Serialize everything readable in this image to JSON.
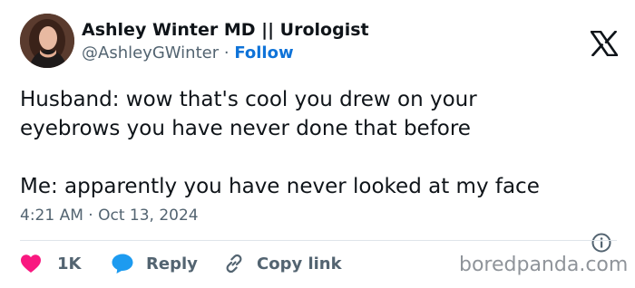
{
  "author": {
    "display_name": "Ashley Winter MD || Urologist",
    "handle": "@AshleyGWinter",
    "separator": "·",
    "follow_label": "Follow"
  },
  "tweet": {
    "text": "Husband: wow that's cool you drew on your\neyebrows you have never done that before\n\nMe: apparently you have never looked at my face",
    "timestamp": "4:21 AM · Oct 13, 2024"
  },
  "actions": {
    "like_count": "1K",
    "reply_label": "Reply",
    "copy_link_label": "Copy link"
  },
  "watermark": "boredpanda.com",
  "colors": {
    "like": "#f91880",
    "reply": "#1d9bf0",
    "follow": "#0f73d8",
    "muted": "#536471"
  },
  "icons": {
    "brand": "x-logo-icon",
    "like": "heart-icon",
    "reply": "speech-bubble-icon",
    "copy_link": "link-icon",
    "info": "info-icon"
  }
}
